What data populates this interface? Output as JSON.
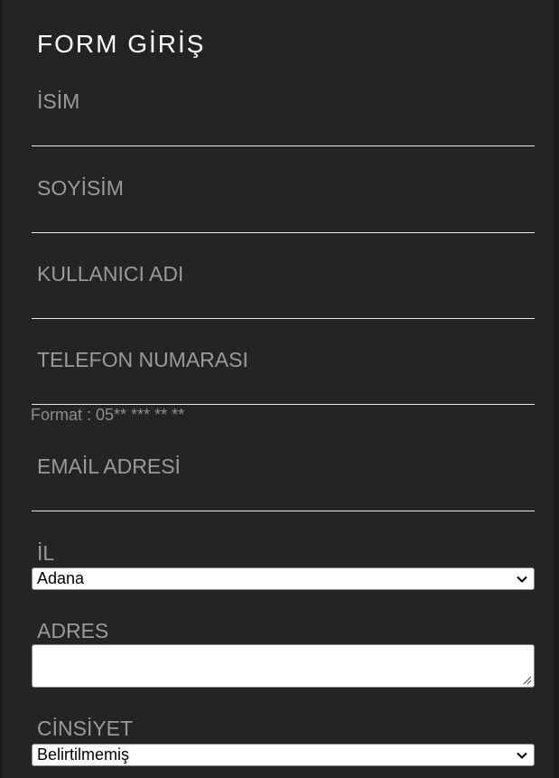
{
  "form": {
    "title": "FORM GİRİŞ",
    "fields": {
      "first_name": {
        "label": "İSİM"
      },
      "last_name": {
        "label": "SOYİSİM"
      },
      "username": {
        "label": "KULLANICI ADI"
      },
      "phone": {
        "label": "TELEFON NUMARASI",
        "hint": "Format : 05** *** ** **"
      },
      "email": {
        "label": "EMAİL ADRESİ"
      },
      "city": {
        "label": "İL",
        "selected": "Adana"
      },
      "address": {
        "label": "ADRES",
        "value": ""
      },
      "gender": {
        "label": "CİNSİYET",
        "selected": "Belirtilmemiş"
      }
    }
  },
  "icons": {
    "select_arrow": "chevron-down-icon",
    "resize": "resize-grip-icon"
  },
  "colors": {
    "background": "#242424",
    "title": "#ffffff",
    "label": "#9a9a9a",
    "underline": "#e8e8e8"
  }
}
